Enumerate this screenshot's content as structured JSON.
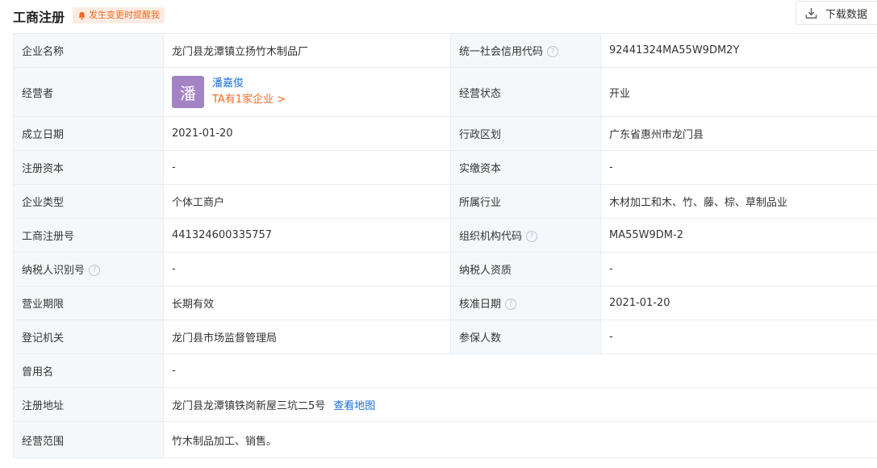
{
  "header": {
    "title": "工商注册",
    "remind_label": "发生变更时提醒我",
    "download_label": "下载数据"
  },
  "rows": {
    "r1": {
      "l1": "企业名称",
      "v1": "龙门县龙潭镇立扬竹木制品厂",
      "l2": "统一社会信用代码",
      "v2": "92441324MA55W9DM2Y"
    },
    "r2": {
      "l1": "经营者",
      "avatar_char": "潘",
      "owner_name": "潘嘉俊",
      "owner_link": "TA有1家企业 >",
      "l2": "经营状态",
      "v2": "开业"
    },
    "r3": {
      "l1": "成立日期",
      "v1": "2021-01-20",
      "l2": "行政区划",
      "v2": "广东省惠州市龙门县"
    },
    "r4": {
      "l1": "注册资本",
      "v1": "-",
      "l2": "实缴资本",
      "v2": "-"
    },
    "r5": {
      "l1": "企业类型",
      "v1": "个体工商户",
      "l2": "所属行业",
      "v2": "木材加工和木、竹、藤、棕、草制品业"
    },
    "r6": {
      "l1": "工商注册号",
      "v1": "441324600335757",
      "l2": "组织机构代码",
      "v2": "MA55W9DM-2"
    },
    "r7": {
      "l1": "纳税人识别号",
      "v1": "-",
      "l2": "纳税人资质",
      "v2": "-"
    },
    "r8": {
      "l1": "营业期限",
      "v1": "长期有效",
      "l2": "核准日期",
      "v2": "2021-01-20"
    },
    "r9": {
      "l1": "登记机关",
      "v1": "龙门县市场监督管理局",
      "l2": "参保人数",
      "v2": "-"
    },
    "r10": {
      "l1": "曾用名",
      "v1": "-"
    },
    "r11": {
      "l1": "注册地址",
      "v1": "龙门县龙潭镇铁岗新屋三坑二5号",
      "map_link": "查看地图"
    },
    "r12": {
      "l1": "经营范围",
      "v1": "竹木制品加工、销售。"
    }
  },
  "help_glyph": "?",
  "colors": {
    "accent_orange": "#f26a21",
    "link_blue": "#1a6fd6",
    "label_bg": "#f5f8fb",
    "avatar_bg": "#a483c4"
  }
}
